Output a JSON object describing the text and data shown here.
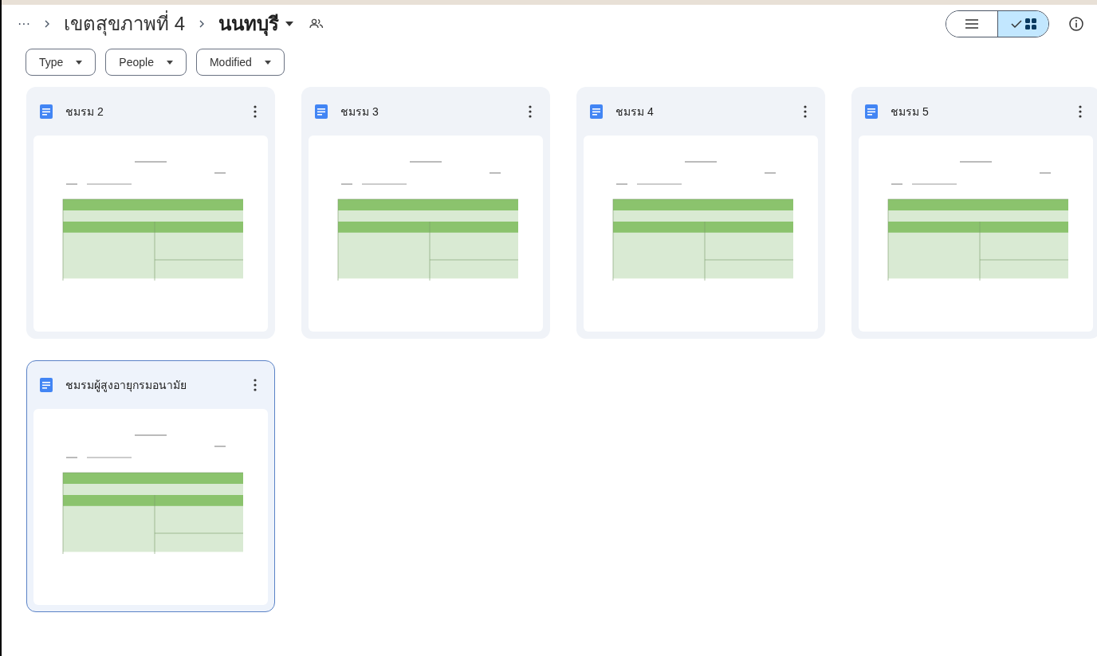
{
  "breadcrumb": {
    "more": "···",
    "items": [
      {
        "label": "เขตสุขภาพที่ 4",
        "current": false
      },
      {
        "label": "นนทบุรี",
        "current": true
      }
    ]
  },
  "view_toggle": [
    {
      "kind": "list",
      "selected": false
    },
    {
      "kind": "grid",
      "selected": true
    }
  ],
  "filters": [
    {
      "label": "Type"
    },
    {
      "label": "People"
    },
    {
      "label": "Modified"
    }
  ],
  "files": [
    {
      "name": "ชมรม 2",
      "selected": false
    },
    {
      "name": "ชมรม 3",
      "selected": false
    },
    {
      "name": "ชมรม 4",
      "selected": false
    },
    {
      "name": "ชมรม 5",
      "selected": false
    },
    {
      "name": "ชมรมผู้สูงอายุกรมอนามัย",
      "selected": true
    }
  ]
}
